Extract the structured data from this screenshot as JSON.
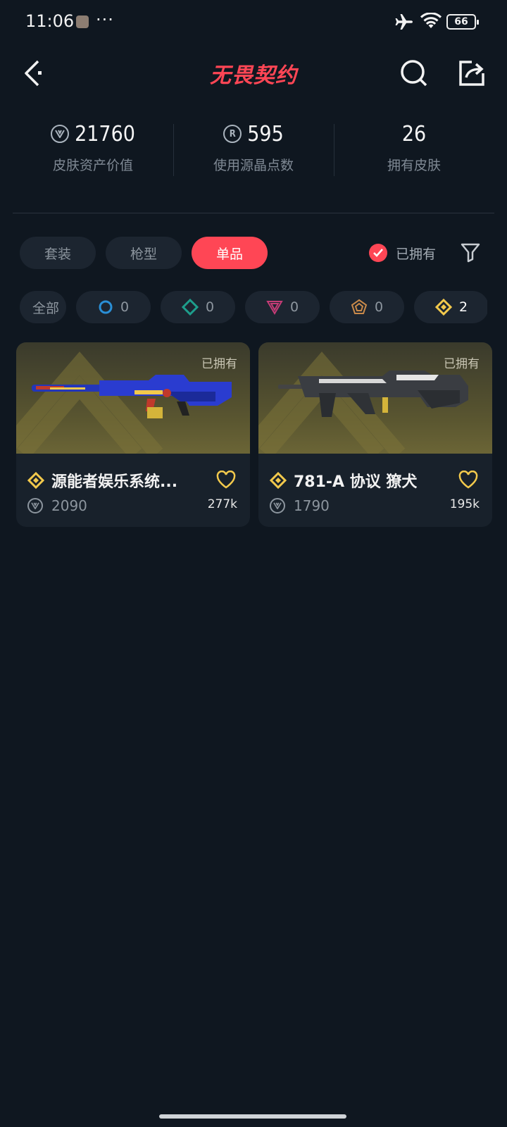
{
  "status_bar": {
    "time": "11:06",
    "dots": "···",
    "battery": "66"
  },
  "header": {
    "title": "无畏契约"
  },
  "stats": [
    {
      "value": "21760",
      "label": "皮肤资产价值",
      "icon": "vp-coin-icon"
    },
    {
      "value": "595",
      "label": "使用源晶点数",
      "icon": "radianite-icon"
    },
    {
      "value": "26",
      "label": "拥有皮肤",
      "icon": ""
    }
  ],
  "tabs": {
    "bundle": "套装",
    "gun_type": "枪型",
    "single": "单品"
  },
  "owned_filter": {
    "label": "已拥有",
    "checked": true
  },
  "rarity_chips": [
    {
      "label": "全部",
      "count": ""
    },
    {
      "label": "",
      "count": "0",
      "icon": "select-tier-icon",
      "color": "#2a8fd6"
    },
    {
      "label": "",
      "count": "0",
      "icon": "deluxe-tier-icon",
      "color": "#1e9e8c"
    },
    {
      "label": "",
      "count": "0",
      "icon": "premium-tier-icon",
      "color": "#c43c76"
    },
    {
      "label": "",
      "count": "0",
      "icon": "ultra-tier-icon",
      "color": "#c98a4a"
    },
    {
      "label": "",
      "count": "2",
      "icon": "exclusive-tier-icon",
      "color": "#f2c94c"
    }
  ],
  "skins": [
    {
      "name": "源能者娱乐系统...",
      "owned_tag": "已拥有",
      "price": "2090",
      "likes": "277k",
      "tier_color": "#f2c94c"
    },
    {
      "name": "781-A 协议 獠犬",
      "owned_tag": "已拥有",
      "price": "1790",
      "likes": "195k",
      "tier_color": "#f2c94c"
    }
  ],
  "colors": {
    "accent": "#ff4655",
    "background": "#0f1720",
    "card": "#18212b",
    "chip": "#1c2530"
  }
}
